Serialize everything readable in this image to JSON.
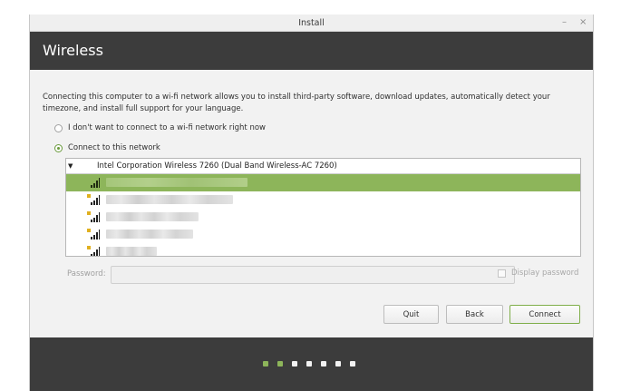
{
  "window": {
    "title": "Install",
    "minimize_glyph": "–",
    "close_glyph": "×"
  },
  "header": {
    "title": "Wireless"
  },
  "description": "Connecting this computer to a wi-fi network allows you to install third-party software, download updates, automatically detect your timezone, and install full support for your language.",
  "options": {
    "no_wifi_label": "I don't want to connect to a wi-fi network right now",
    "connect_label": "Connect to this network",
    "selected": "connect"
  },
  "network_list": {
    "group_label": "Intel Corporation Wireless 7260 (Dual Band Wireless-AC 7260)",
    "networks": [
      {
        "secured": false,
        "selected": true,
        "ssid": ""
      },
      {
        "secured": true,
        "selected": false,
        "ssid": ""
      },
      {
        "secured": true,
        "selected": false,
        "ssid": ""
      },
      {
        "secured": true,
        "selected": false,
        "ssid": ""
      },
      {
        "secured": true,
        "selected": false,
        "ssid": ""
      }
    ]
  },
  "password": {
    "label": "Password:",
    "value": "",
    "display_label": "Display password"
  },
  "buttons": {
    "quit": "Quit",
    "back": "Back",
    "connect": "Connect"
  },
  "progress": {
    "total_steps": 7,
    "completed_steps": 2
  },
  "colors": {
    "accent": "#8db55a",
    "header_bg": "#3c3c3c"
  }
}
